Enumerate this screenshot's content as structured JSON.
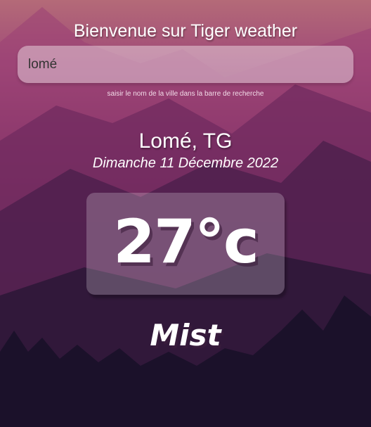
{
  "header": {
    "title": "Bienvenue sur Tiger weather"
  },
  "search": {
    "value": "lomé",
    "hint": "saisir le nom de la ville dans la barre de recherche"
  },
  "location": {
    "city": "Lomé, TG",
    "date": "Dimanche 11 Décembre 2022"
  },
  "weather": {
    "temperature": "27°c",
    "condition": "Mist"
  },
  "background": {
    "icon": "mountain-landscape-illustration"
  }
}
